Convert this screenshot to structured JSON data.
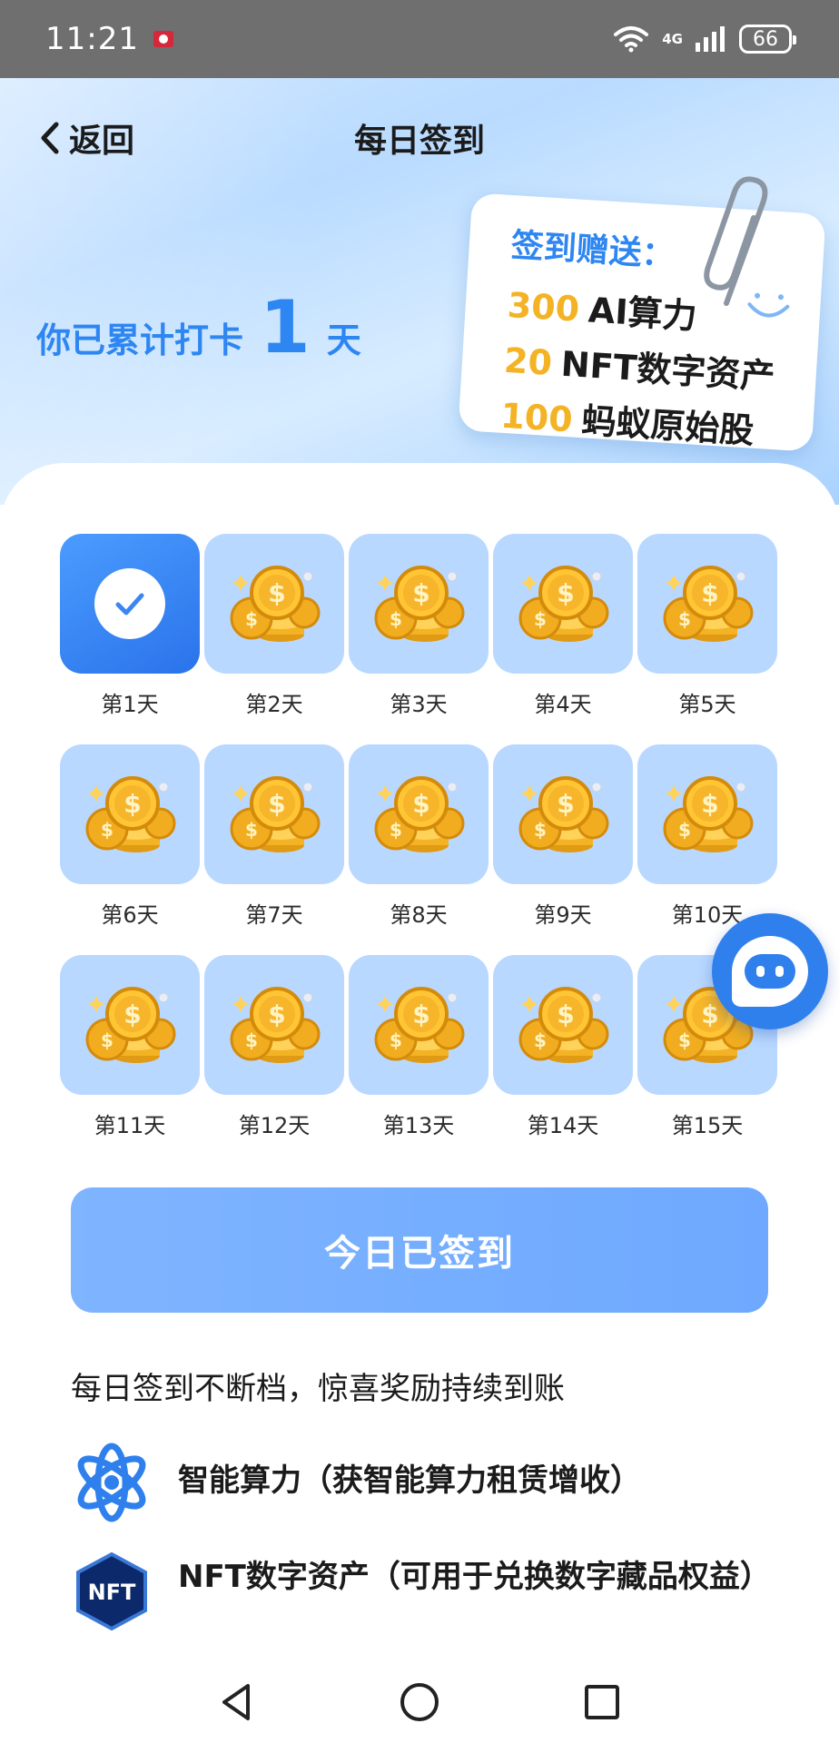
{
  "status_bar": {
    "time": "11:21",
    "network": "4G",
    "battery": "66"
  },
  "header": {
    "back_label": "返回",
    "title": "每日签到"
  },
  "streak": {
    "prefix": "你已累计打卡",
    "count": "1",
    "unit": "天"
  },
  "gift_card": {
    "title": "签到赠送：",
    "rewards": [
      {
        "amount": "300",
        "item": "AI算力"
      },
      {
        "amount": "20",
        "item": "NFT数字资产"
      },
      {
        "amount": "100",
        "item": "蚂蚁原始股"
      }
    ]
  },
  "days": [
    {
      "label": "第1天",
      "signed": true
    },
    {
      "label": "第2天",
      "signed": false
    },
    {
      "label": "第3天",
      "signed": false
    },
    {
      "label": "第4天",
      "signed": false
    },
    {
      "label": "第5天",
      "signed": false
    },
    {
      "label": "第6天",
      "signed": false
    },
    {
      "label": "第7天",
      "signed": false
    },
    {
      "label": "第8天",
      "signed": false
    },
    {
      "label": "第9天",
      "signed": false
    },
    {
      "label": "第10天",
      "signed": false
    },
    {
      "label": "第11天",
      "signed": false
    },
    {
      "label": "第12天",
      "signed": false
    },
    {
      "label": "第13天",
      "signed": false
    },
    {
      "label": "第14天",
      "signed": false
    },
    {
      "label": "第15天",
      "signed": false
    }
  ],
  "sign_button": {
    "label": "今日已签到"
  },
  "promo": {
    "text": "每日签到不断档，惊喜奖励持续到账"
  },
  "benefits": [
    {
      "icon": "atom-icon",
      "text": "智能算力（获智能算力租赁增收）"
    },
    {
      "icon": "nft-badge-icon",
      "text": "NFT数字资产（可用于兑换数字藏品权益）",
      "badge": "NFT"
    }
  ],
  "colors": {
    "accent": "#2e86f2",
    "gold": "#f3b324",
    "tile": "#b9d8ff",
    "button": "#7fb4ff"
  }
}
